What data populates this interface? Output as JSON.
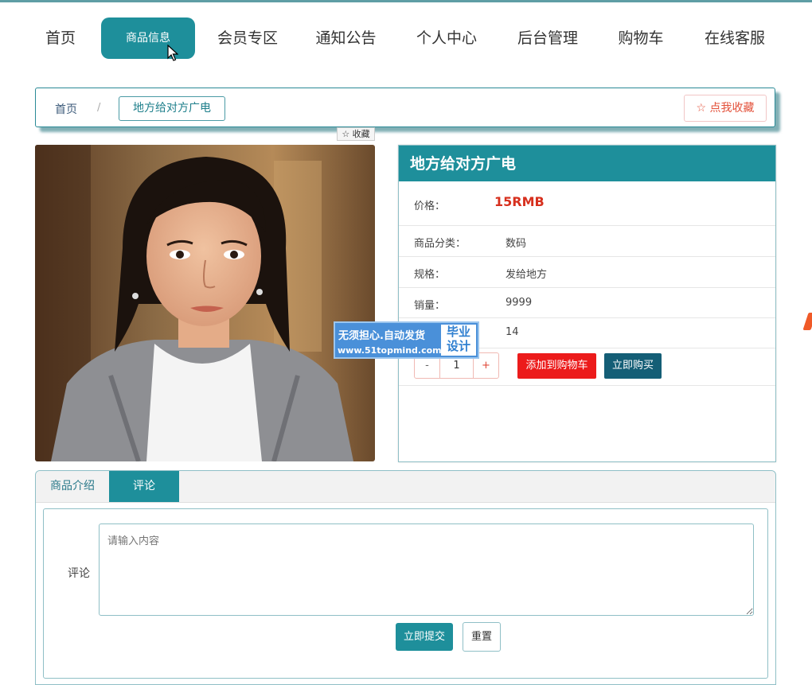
{
  "nav": {
    "items": [
      "首页",
      "商品信息",
      "会员专区",
      "通知公告",
      "个人中心",
      "后台管理",
      "购物车",
      "在线客服"
    ]
  },
  "breadcrumb": {
    "home": "首页",
    "separator": "/",
    "current": "地方给对方广电",
    "favorite": "☆ 点我收藏"
  },
  "mini_favorite": "☆ 收藏",
  "product": {
    "title": "地方给对方广电",
    "price_label": "价格：",
    "price": "15RMB",
    "category_label": "商品分类：",
    "category": "数码",
    "spec_label": "规格：",
    "spec": "发给地方",
    "sales_label": "销量：",
    "sales": "9999",
    "row5_value": "14",
    "quantity": "1",
    "minus": "-",
    "plus": "+",
    "add_to_cart": "添加到购物车",
    "buy_now": "立即购买"
  },
  "watermark": {
    "line1": "无须担心.自动发货",
    "line2": "www.51topmind.com",
    "tag_line1": "毕业",
    "tag_line2": "设计"
  },
  "tabs": {
    "intro": "商品介绍",
    "comment": "评论"
  },
  "comment": {
    "label": "评论",
    "placeholder": "请输入内容",
    "submit": "立即提交",
    "reset": "重置"
  },
  "colors": {
    "accent": "#1e8f9b",
    "price": "#d7301e",
    "cart_button": "#ec1b1b",
    "buy_button": "#145e76"
  }
}
